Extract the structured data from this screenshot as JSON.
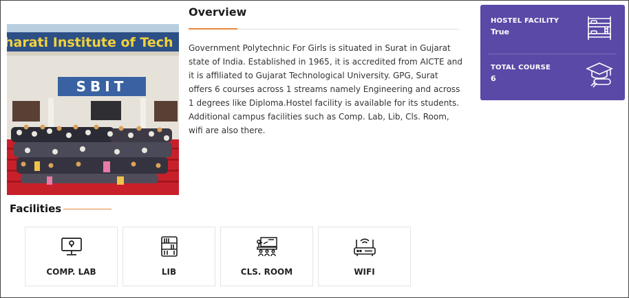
{
  "photo": {
    "alt_sign_text": "harati Institute of Tech",
    "badge_text": "SBIT"
  },
  "overview": {
    "title": "Overview",
    "description": "Government Polytechnic For Girls is situated in Surat in Gujarat state of India. Established in 1965, it is accredited from AICTE and it is affiliated to Gujarat Technological University. GPG, Surat offers 6 courses across 1 streams namely Engineering and across 1 degrees like Diploma.Hostel facility is available for its students. Additional campus facilities such as Comp. Lab, Lib, Cls. Room, wifi are also there."
  },
  "info_card": {
    "accent_color": "#5a49a6",
    "hostel": {
      "label": "HOSTEL FACILITY",
      "value": "True",
      "icon": "bunk-bed-icon"
    },
    "courses": {
      "label": "TOTAL COURSE",
      "value": "6",
      "icon": "graduation-cap-icon"
    }
  },
  "facilities": {
    "title": "Facilities",
    "items": [
      {
        "label": "COMP. LAB",
        "icon": "computer-monitor-icon"
      },
      {
        "label": "LIB",
        "icon": "bookshelf-icon"
      },
      {
        "label": "CLS. ROOM",
        "icon": "classroom-icon"
      },
      {
        "label": "WIFI",
        "icon": "wifi-router-icon"
      }
    ]
  }
}
